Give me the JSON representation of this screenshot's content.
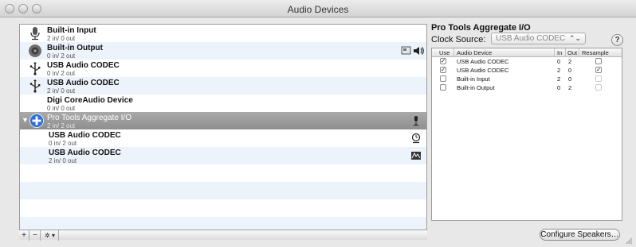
{
  "window": {
    "title": "Audio Devices"
  },
  "devices": [
    {
      "name": "Built-in Input",
      "io": "2 in/ 0 out",
      "icon": "microphone-icon",
      "right_icons": []
    },
    {
      "name": "Built-in Output",
      "io": "0 in/ 2 out",
      "icon": "speaker-icon",
      "right_icons": [
        "finder-icon",
        "speaker-icon"
      ]
    },
    {
      "name": "USB Audio CODEC",
      "io": "0 in/ 2 out",
      "icon": "usb-icon",
      "right_icons": []
    },
    {
      "name": "USB Audio CODEC",
      "io": "2 in/ 0 out",
      "icon": "usb-icon",
      "right_icons": []
    },
    {
      "name": "Digi CoreAudio Device",
      "io": "0 in/ 0 out",
      "icon": "",
      "right_icons": []
    },
    {
      "name": "Pro Tools Aggregate I/O",
      "io": "2 in/ 2 out",
      "icon": "aggregate-plus-icon",
      "expanded": true,
      "selected": true,
      "right_icons": [
        "microphone-icon"
      ]
    },
    {
      "name": "USB Audio CODEC",
      "io": "0 in/ 2 out",
      "icon": "",
      "child": true,
      "right_icons": [
        "clock-icon"
      ]
    },
    {
      "name": "USB Audio CODEC",
      "io": "2 in/ 0 out",
      "icon": "",
      "child": true,
      "right_icons": [
        "waveform-icon"
      ]
    }
  ],
  "list_toolbar": {
    "add": "+",
    "remove": "−",
    "action": "✲ ▾"
  },
  "panel": {
    "title": "Pro Tools Aggregate I/O",
    "clock_source_label": "Clock Source:",
    "clock_source_value": "USB Audio CODEC",
    "help": "?",
    "columns": {
      "use": "Use",
      "device": "Audio Device",
      "in": "In",
      "out": "Out",
      "resample": "Resample"
    },
    "rows": [
      {
        "use": true,
        "device": "USB Audio CODEC",
        "in": "0",
        "out": "2",
        "resample": false,
        "resample_enabled": true
      },
      {
        "use": true,
        "device": "USB Audio CODEC",
        "in": "2",
        "out": "0",
        "resample": true,
        "resample_enabled": true
      },
      {
        "use": false,
        "device": "Built-in Input",
        "in": "2",
        "out": "0",
        "resample": false,
        "resample_enabled": false
      },
      {
        "use": false,
        "device": "Built-in Output",
        "in": "0",
        "out": "2",
        "resample": false,
        "resample_enabled": false
      }
    ],
    "configure_button": "Configure Speakers…"
  },
  "colors": {
    "selected_row": "#999999",
    "alt_row": "#edf3fb",
    "aggregate_icon": "#2f6fd6"
  }
}
